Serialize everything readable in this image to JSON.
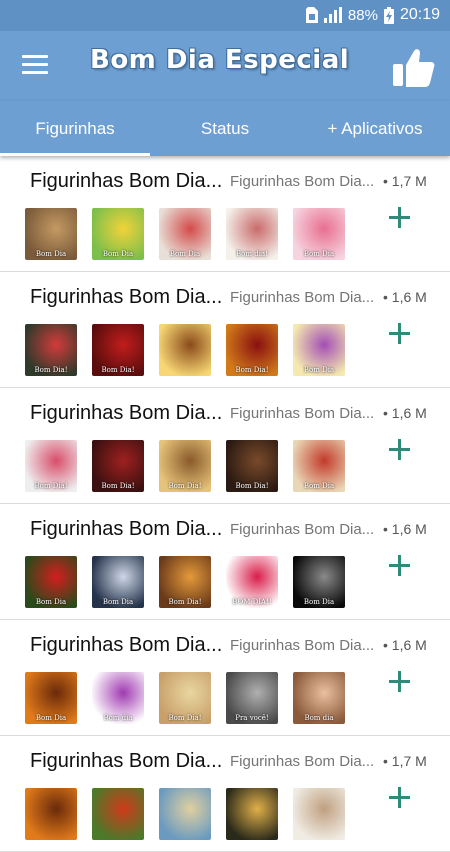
{
  "status_bar": {
    "battery": "88%",
    "time": "20:19",
    "icons": [
      "sim-icon",
      "signal-icon",
      "battery-icon"
    ]
  },
  "app_bar": {
    "title": "Bom Dia Especial",
    "menu_icon": "hamburger-menu-icon",
    "action_icon": "thumbs-up-icon"
  },
  "tabs": [
    {
      "label": "Figurinhas",
      "selected": true
    },
    {
      "label": "Status",
      "selected": false
    },
    {
      "label": "+ Aplicativos",
      "selected": false
    }
  ],
  "packs": [
    {
      "name": "Figurinhas Bom Dia...",
      "author": "Figurinhas Bom Dia...",
      "size": "• 1,7 M",
      "thumbs": [
        {
          "colors": [
            "#7a5a3a",
            "#c49a63"
          ],
          "label": "Bom Dia"
        },
        {
          "colors": [
            "#7cbf4a",
            "#f2d23a"
          ],
          "label": "Bom Dia"
        },
        {
          "colors": [
            "#e8e0d8",
            "#d44b4b"
          ],
          "label": "Bom Dia"
        },
        {
          "colors": [
            "#f4f0ea",
            "#c96b6b"
          ],
          "label": "Bom dia!"
        },
        {
          "colors": [
            "#f6d3df",
            "#e86f8f"
          ],
          "label": "Bom Dia"
        }
      ]
    },
    {
      "name": "Figurinhas Bom Dia...",
      "author": "Figurinhas Bom Dia...",
      "size": "• 1,6 M",
      "thumbs": [
        {
          "colors": [
            "#2f3a2a",
            "#d23b3b"
          ],
          "label": "Bom Dia!"
        },
        {
          "colors": [
            "#5a0d0d",
            "#c21d1d"
          ],
          "label": "Bom Dia!"
        },
        {
          "colors": [
            "#f7d774",
            "#8a4a1a"
          ],
          "label": ""
        },
        {
          "colors": [
            "#d07a1a",
            "#8a1010"
          ],
          "label": "Bom Dia!"
        },
        {
          "colors": [
            "#f5e9b0",
            "#a34fb5"
          ],
          "label": "Bom Dia"
        }
      ]
    },
    {
      "name": "Figurinhas Bom Dia...",
      "author": "Figurinhas Bom Dia...",
      "size": "• 1,6 M",
      "thumbs": [
        {
          "colors": [
            "#eeeeee",
            "#d94d6a"
          ],
          "label": "Bom Dia!"
        },
        {
          "colors": [
            "#3a1010",
            "#a02020"
          ],
          "label": "Bom Dia!"
        },
        {
          "colors": [
            "#e6c37a",
            "#8a5a2a"
          ],
          "label": "Bom Dia!"
        },
        {
          "colors": [
            "#2a1a12",
            "#7a4a2a"
          ],
          "label": "Bom Dia!"
        },
        {
          "colors": [
            "#e9d6b5",
            "#c23a2a"
          ],
          "label": "Bom Dia"
        }
      ]
    },
    {
      "name": "Figurinhas Bom Dia...",
      "author": "Figurinhas Bom Dia...",
      "size": "• 1,6 M",
      "thumbs": [
        {
          "colors": [
            "#2a4a1a",
            "#d21e1e"
          ],
          "label": "Bom Dia"
        },
        {
          "colors": [
            "#24324a",
            "#cfd8e8"
          ],
          "label": "Bom Dia"
        },
        {
          "colors": [
            "#6a3a1a",
            "#e59a3a"
          ],
          "label": "Bom Dia!"
        },
        {
          "colors": [
            "#ffffff",
            "#d91d4a"
          ],
          "label": "BOM DIA!!"
        },
        {
          "colors": [
            "#0a0a0a",
            "#8a8a8a"
          ],
          "label": "Bom Dia"
        }
      ]
    },
    {
      "name": "Figurinhas Bom Dia...",
      "author": "Figurinhas Bom Dia...",
      "size": "• 1,6 M",
      "thumbs": [
        {
          "colors": [
            "#e07a1a",
            "#6a2a0a"
          ],
          "label": "Bom Dia"
        },
        {
          "colors": [
            "#ffffff",
            "#a03ab0"
          ],
          "label": "Bom dia"
        },
        {
          "colors": [
            "#c9a06a",
            "#e9d6a0"
          ],
          "label": "Bom Dia!"
        },
        {
          "colors": [
            "#4a4a4a",
            "#b0b0b0"
          ],
          "label": "Pra você!"
        },
        {
          "colors": [
            "#8a5a3a",
            "#e9c0a0"
          ],
          "label": "Bom dia"
        }
      ]
    },
    {
      "name": "Figurinhas Bom Dia...",
      "author": "Figurinhas Bom Dia...",
      "size": "• 1,7 M",
      "thumbs": [
        {
          "colors": [
            "#e07a1a",
            "#6a2a0a"
          ],
          "label": ""
        },
        {
          "colors": [
            "#4a7a2a",
            "#d03a1a"
          ],
          "label": ""
        },
        {
          "colors": [
            "#6a9ac0",
            "#e0d0a0"
          ],
          "label": ""
        },
        {
          "colors": [
            "#2a2a1a",
            "#e0b04a"
          ],
          "label": ""
        },
        {
          "colors": [
            "#f0ece4",
            "#c0a080"
          ],
          "label": ""
        }
      ]
    }
  ],
  "colors": {
    "app_bar": "#6e9fd2",
    "status_bar": "#5f91c4",
    "add_icon": "#2e8b77"
  }
}
